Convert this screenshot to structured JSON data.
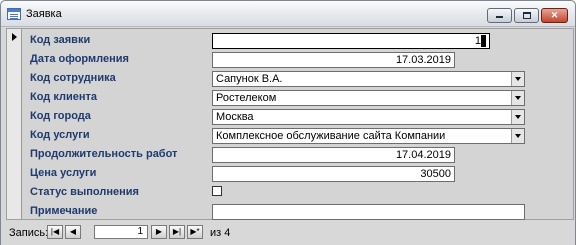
{
  "window": {
    "title": "Заявка",
    "min_icon": "minimize-icon",
    "max_icon": "maximize-icon",
    "close_icon": "close-icon",
    "close_glyph": "✕"
  },
  "form": {
    "fields": {
      "order_id": {
        "label": "Код заявки",
        "value": "1"
      },
      "issue_date": {
        "label": "Дата оформления",
        "value": "17.03.2019"
      },
      "employee": {
        "label": "Код сотрудника",
        "value": "Сапунок В.А."
      },
      "client": {
        "label": "Код клиента",
        "value": "Ростелеком"
      },
      "city": {
        "label": "Код города",
        "value": "Москва"
      },
      "service": {
        "label": "Код услуги",
        "value": "Комплексное обслуживание сайта Компании"
      },
      "duration": {
        "label": "Продолжительность работ",
        "value": "17.04.2019"
      },
      "price": {
        "label": "Цена услуги",
        "value": "30500"
      },
      "status": {
        "label": "Статус выполнения",
        "checked": false
      },
      "note": {
        "label": "Примечание",
        "value": ""
      }
    }
  },
  "navigation": {
    "label": "Запись:",
    "current_record": "1",
    "of_text": "из 4",
    "first_glyph": "|◀",
    "prev_glyph": "◀",
    "next_glyph": "▶",
    "last_glyph": "▶|",
    "new_glyph": "▶*"
  },
  "colors": {
    "label_text": "#1f3a6e",
    "background": "#d4d4d4",
    "close_button": "#c4452e"
  }
}
